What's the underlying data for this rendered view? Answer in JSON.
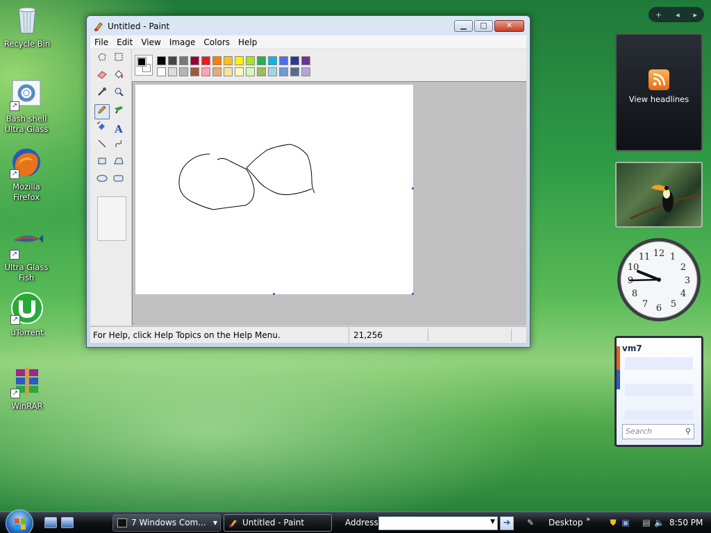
{
  "desktop": {
    "icons": [
      {
        "label": "Recycle Bin",
        "icon": "recycle-bin-icon"
      },
      {
        "label": "Bash shell Ultra Glass",
        "icon": "bash-shell-icon"
      },
      {
        "label": "Mozilla Firefox",
        "icon": "firefox-icon"
      },
      {
        "label": "Ultra Glass Fish",
        "icon": "fish-icon"
      },
      {
        "label": "uTorrent",
        "icon": "utorrent-icon"
      },
      {
        "label": "WinRAR",
        "icon": "winrar-icon"
      }
    ]
  },
  "paint": {
    "title": "Paint",
    "menus": [
      "File",
      "Edit",
      "View",
      "Image",
      "Colors",
      "Help"
    ],
    "status_help": "For Help, click Help Topics on the Help Menu.",
    "status_coords": "21,256",
    "palette_colors": [
      "#000000",
      "#464646",
      "#787878",
      "#990030",
      "#ed1c24",
      "#ff7e00",
      "#ffc20e",
      "#fff200",
      "#a8e61d",
      "#22b14c",
      "#00b7ef",
      "#4d6df3",
      "#2f3699",
      "#6f3198",
      "#ffffff",
      "#dcdcdc",
      "#b4b4b4",
      "#9c5a3c",
      "#ffa3b1",
      "#e5aa7a",
      "#f5e49c",
      "#fff9bd",
      "#d3f9bc",
      "#9dbb61",
      "#99d9ea",
      "#709ad1",
      "#546d8e",
      "#b5a5d5"
    ],
    "title_prefix": "Untitled"
  },
  "sidebar": {
    "feed_label": "View headlines",
    "notes_title": "vm7",
    "notes_search_placeholder": "Search"
  },
  "taskbar": {
    "tasks": [
      {
        "label": "7 Windows Com..."
      },
      {
        "label": "Untitled - Paint"
      }
    ],
    "address_label": "Address",
    "address_value": "",
    "desktop_label": "Desktop",
    "clock": "8:50 PM"
  }
}
